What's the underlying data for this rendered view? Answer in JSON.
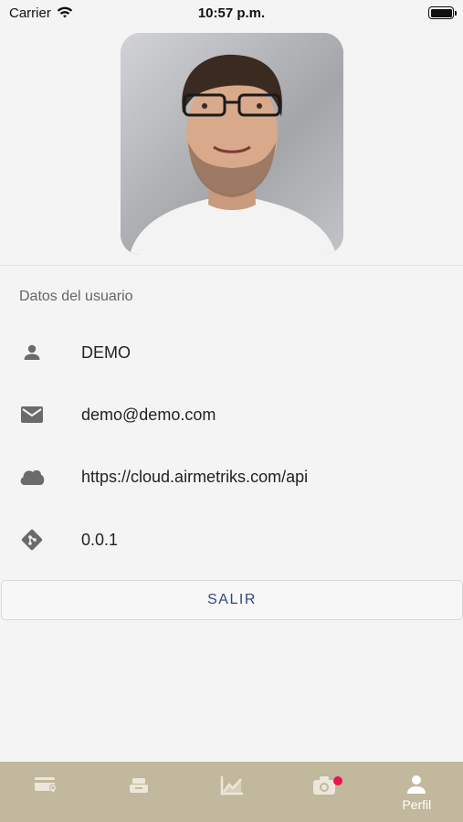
{
  "status_bar": {
    "carrier": "Carrier",
    "time": "10:57 p.m."
  },
  "profile": {
    "section_title": "Datos del usuario",
    "rows": [
      {
        "icon": "person-icon",
        "value": "DEMO"
      },
      {
        "icon": "mail-icon",
        "value": "demo@demo.com"
      },
      {
        "icon": "cloud-icon",
        "value": "https://cloud.airmetriks.com/api"
      },
      {
        "icon": "git-icon",
        "value": "0.0.1"
      }
    ],
    "logout_label": "SALIR"
  },
  "tab_bar": {
    "tabs": [
      {
        "icon": "location-card-icon",
        "label": ""
      },
      {
        "icon": "tray-icon",
        "label": ""
      },
      {
        "icon": "chart-icon",
        "label": ""
      },
      {
        "icon": "camera-icon",
        "label": "",
        "badge": true
      },
      {
        "icon": "person-icon",
        "label": "Perfil",
        "active": true
      }
    ]
  },
  "colors": {
    "tab_bar_bg": "#c1b89d",
    "button_text": "#2e4a7d",
    "badge": "#e8164d"
  }
}
